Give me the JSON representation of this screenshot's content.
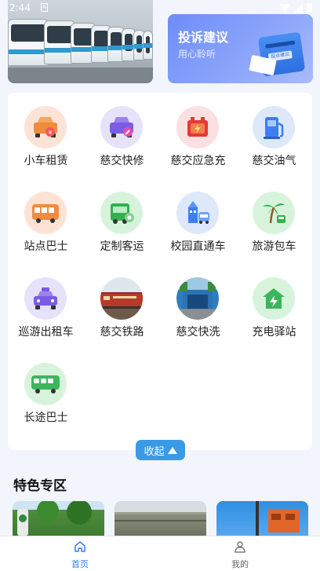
{
  "status_bar": {
    "time": "2:44",
    "sim_label": "A"
  },
  "banners": {
    "complaint": {
      "title": "投诉建议",
      "subtitle": "用心聆听",
      "box_label": "投诉建议"
    }
  },
  "services": [
    {
      "label": "小车租赁",
      "icon": "car-rental-icon",
      "bg": "#fde3d6"
    },
    {
      "label": "慈交快修",
      "icon": "car-repair-icon",
      "bg": "#e7e2fb"
    },
    {
      "label": "慈交应急充",
      "icon": "emergency-battery-icon",
      "bg": "#fbdfe1"
    },
    {
      "label": "慈交油气",
      "icon": "fuel-station-icon",
      "bg": "#dde8fb"
    },
    {
      "label": "站点巴士",
      "icon": "station-bus-icon",
      "bg": "#fde3d6"
    },
    {
      "label": "定制客运",
      "icon": "custom-transit-icon",
      "bg": "#d8f3dc"
    },
    {
      "label": "校园直通车",
      "icon": "campus-shuttle-icon",
      "bg": "#dde8fb"
    },
    {
      "label": "旅游包车",
      "icon": "tour-charter-icon",
      "bg": "#d8f3dc"
    },
    {
      "label": "巡游出租车",
      "icon": "taxi-icon",
      "bg": "#e7e2fb"
    },
    {
      "label": "慈交铁路",
      "icon": "railway-photo-icon",
      "bg": "#c9b7a5"
    },
    {
      "label": "慈交快洗",
      "icon": "car-wash-photo-icon",
      "bg": "#6aa3c9"
    },
    {
      "label": "充电驿站",
      "icon": "charging-station-icon",
      "bg": "#d8f3dc"
    },
    {
      "label": "长途巴士",
      "icon": "long-distance-bus-icon",
      "bg": "#d8f3dc"
    }
  ],
  "collapse_button": {
    "label": "收起"
  },
  "featured": {
    "title": "特色专区"
  },
  "tabbar": {
    "tabs": [
      {
        "label": "首页",
        "icon": "home-icon",
        "active": true
      },
      {
        "label": "我的",
        "icon": "user-icon",
        "active": false
      }
    ]
  },
  "colors": {
    "accent": "#3b9ae6",
    "active_tab": "#3b7ff0",
    "inactive_tab": "#666666"
  }
}
